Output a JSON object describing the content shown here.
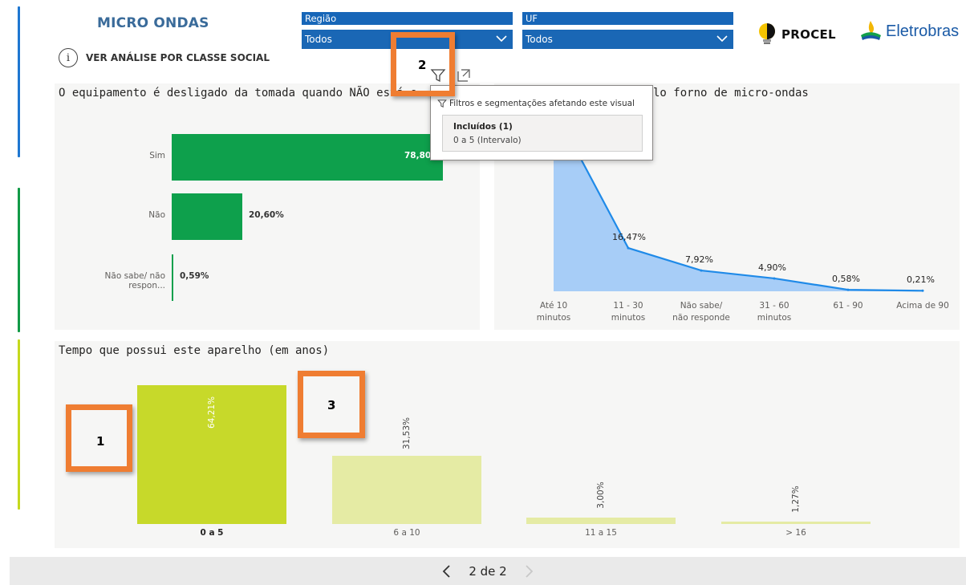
{
  "header": {
    "title": "MICRO ONDAS",
    "info_link": "VER ANÁLISE POR CLASSE SOCIAL",
    "info_glyph": "i",
    "logos": {
      "procel": "PROCEL",
      "eletrobras": "Eletrobras"
    }
  },
  "slicers": [
    {
      "label": "Região",
      "value": "Todos"
    },
    {
      "label": "UF",
      "value": "Todos"
    }
  ],
  "visual_left": {
    "title": "O equipamento é desligado da tomada quando NÃO está e",
    "bars": [
      {
        "label": "Sim",
        "value": 78.8,
        "display": "78,80"
      },
      {
        "label": "Não",
        "value": 20.6,
        "display": "20,60%"
      },
      {
        "label": "Não sabe/ não respon...",
        "value": 0.59,
        "display": "0,59%"
      }
    ],
    "color": "#0ea04c"
  },
  "visual_right": {
    "title": "lo forno de micro-ondas",
    "chart_data": {
      "type": "area",
      "categories": [
        "Até 10 minutos",
        "11 - 30 minutos",
        "Não sabe/ não responde",
        "31 - 60 minutos",
        "61 - 90",
        "Acima de 90"
      ],
      "tick_lines": [
        [
          "Até 10",
          "minutos"
        ],
        [
          "11 - 30",
          "minutos"
        ],
        [
          "Não sabe/",
          "não responde"
        ],
        [
          "31 - 60",
          "minutos"
        ],
        [
          "61 - 90"
        ],
        [
          "Acima de 90"
        ]
      ],
      "values": [
        69.9,
        16.47,
        7.92,
        4.9,
        0.58,
        0.21
      ],
      "labels": [
        "",
        "16,47%",
        "7,92%",
        "4,90%",
        "0,58%",
        "0,21%"
      ],
      "color": "#a7cdf7",
      "line_color": "#1f8ae8"
    }
  },
  "visual_bottom": {
    "title": "Tempo que possui este aparelho (em anos)",
    "chart_data": {
      "type": "bar",
      "categories": [
        "0 a 5",
        "6 a 10",
        "11 a 15",
        "> 16"
      ],
      "values": [
        64.21,
        31.53,
        3.0,
        1.27
      ],
      "labels": [
        "64,21%",
        "31,53%",
        "3,00%",
        "1,27%"
      ],
      "selected_index": 0,
      "colors": {
        "selected": "#c7d92a",
        "other": "#e5eba4"
      }
    }
  },
  "tooltip": {
    "heading": "Filtros e segmentações afetando este visual",
    "included": "Incluídos (1)",
    "range": "0 a 5 (Intervalo)"
  },
  "callouts": [
    "1",
    "2",
    "3"
  ],
  "footer": {
    "page": "2 de 2"
  }
}
